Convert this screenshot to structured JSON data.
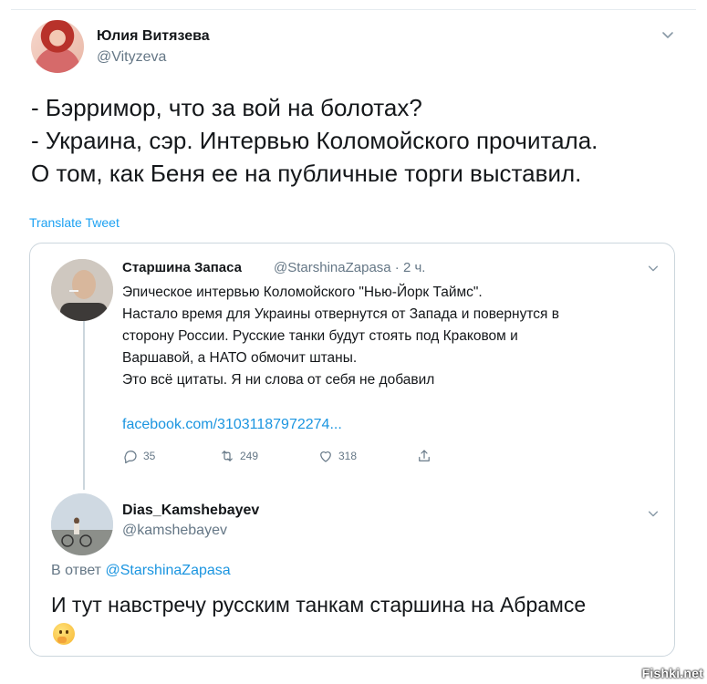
{
  "tweet": {
    "author_name": "Юлия Витязева",
    "author_handle": "@Vityzeva",
    "text_lines": [
      "- Бэрримор, что за вой на болотах?",
      "- Украина, сэр. Интервью Коломойского прочитала.",
      "О том, как Беня ее на публичные торги выставил."
    ],
    "translate_label": "Translate Tweet"
  },
  "quoted": {
    "author_name": "Старшина Запаса",
    "author_handle_time": "@StarshinaZapasa · 2 ч.",
    "text_lines": [
      "Эпическое интервью Коломойского \"Нью-Йорк Таймс\".",
      "Настало время для Украины отвернутся от Запада и повернутся в",
      "сторону России. Русские танки будут стоять под Краковом и",
      "Варшавой, а НАТО обмочит штаны.",
      "Это всё цитаты. Я ни слова от себя не добавил"
    ],
    "link": "facebook.com/31031187972274...",
    "actions": {
      "replies": "35",
      "retweets": "249",
      "likes": "318"
    }
  },
  "reply": {
    "author_name": "Dias_Kamshebayev",
    "author_handle": "@kamshebayev",
    "replying_prefix": "В ответ",
    "replying_to": "@StarshinaZapasa",
    "text": "И тут навстречу русским танкам старшина на Абрамсе",
    "emoji": "thinking-face"
  },
  "watermark": "Fishki.net",
  "colors": {
    "link": "#1b95e0",
    "muted": "#657786",
    "border": "#ccd6dd"
  }
}
